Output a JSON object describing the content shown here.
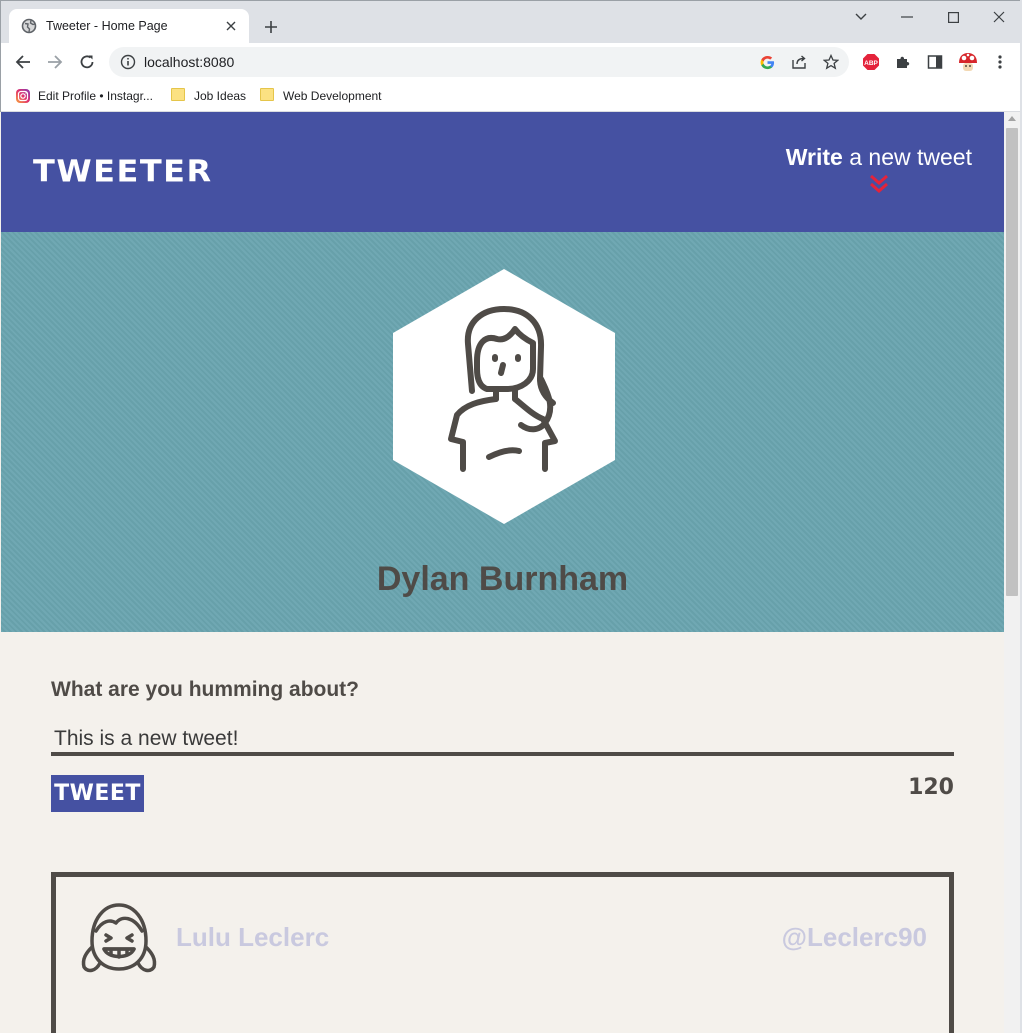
{
  "browser": {
    "tab_title": "Tweeter - Home Page",
    "url": "localhost:8080",
    "bookmarks": [
      {
        "label": "Edit Profile • Instagr...",
        "icon": "instagram-icon"
      },
      {
        "label": "Job Ideas",
        "icon": "folder-icon"
      },
      {
        "label": "Web Development",
        "icon": "folder-icon"
      }
    ]
  },
  "nav": {
    "logo": "TWEETER",
    "compose_bold": "Write",
    "compose_rest": " a new tweet",
    "arrow_icon": "double-chevron-down-icon",
    "arrow_color": "#e4233b"
  },
  "profile": {
    "name": "Dylan Burnham",
    "avatar_icon": "woman-avatar-icon"
  },
  "form": {
    "label": "What are you humming about?",
    "value": "This is a new tweet!",
    "button_label": "TWEET",
    "counter": "120"
  },
  "tweets": [
    {
      "name": "Lulu Leclerc",
      "handle": "@Leclerc90",
      "avatar_icon": "girl-avatar-icon"
    }
  ],
  "colors": {
    "nav_bg": "#4551a2",
    "profile_bg": "#6aa5b0",
    "page_bg": "#f4f1ec",
    "text_dark": "#4f4b47",
    "muted_name": "#c9c9df"
  }
}
